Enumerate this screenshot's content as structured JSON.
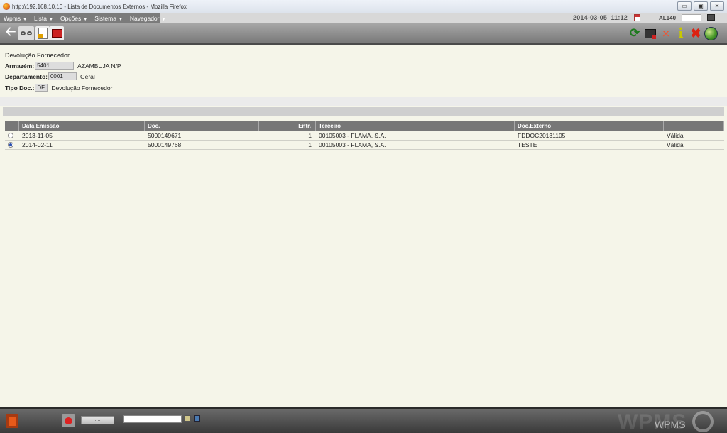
{
  "window": {
    "title": "http://192.168.10.10 - Lista de Documentos Externos - Mozilla Firefox",
    "minimize": "▭",
    "maximize": "▣",
    "close": "✕"
  },
  "menubar": {
    "items": [
      {
        "label": "Wpms",
        "arrow": "▼"
      },
      {
        "label": "Lista",
        "arrow": "▼"
      },
      {
        "label": "Opções",
        "arrow": "▼"
      },
      {
        "label": "Sistema",
        "arrow": "▼"
      },
      {
        "label": "Navegador",
        "arrow": "▼"
      }
    ],
    "date": "2014-03-05",
    "time": "11:12",
    "user": "AL140"
  },
  "toolbar": {
    "icons": [
      "back-arrow-icon",
      "glasses-icon",
      "document-export-icon",
      "print-icon",
      "refresh-icon",
      "screen-icon",
      "collapse-icon",
      "info-icon",
      "close-x-icon",
      "globe-icon"
    ]
  },
  "form": {
    "doc_title": "Devolução Fornecedor",
    "armazem_label": "Armazém:",
    "armazem_code": "5401",
    "armazem_desc": "AZAMBUJA N/P",
    "departamento_label": "Departamento:",
    "departamento_code": "0001",
    "departamento_desc": "Geral",
    "tipo_label": "Tipo Doc.:",
    "tipo_code": "DF",
    "tipo_desc": "Devolução Fornecedor"
  },
  "table": {
    "headers": [
      "Data Emissão",
      "Doc.",
      "Entr.",
      "Terceiro",
      "Doc.Externo",
      ""
    ],
    "rows": [
      {
        "selected": false,
        "data": "2013-11-05",
        "doc": "5000149671",
        "entr": "1",
        "terceiro": "00105003 - FLAMA, S.A.",
        "doc_externo": "FDDOC20131105",
        "estado": "Válida"
      },
      {
        "selected": true,
        "data": "2014-02-11",
        "doc": "5000149768",
        "entr": "1",
        "terceiro": "00105003 - FLAMA, S.A.",
        "doc_externo": "TESTE",
        "estado": "Válida"
      }
    ]
  },
  "statusbar": {
    "button_label": "....",
    "input_value": "",
    "watermark": "WPMS"
  }
}
